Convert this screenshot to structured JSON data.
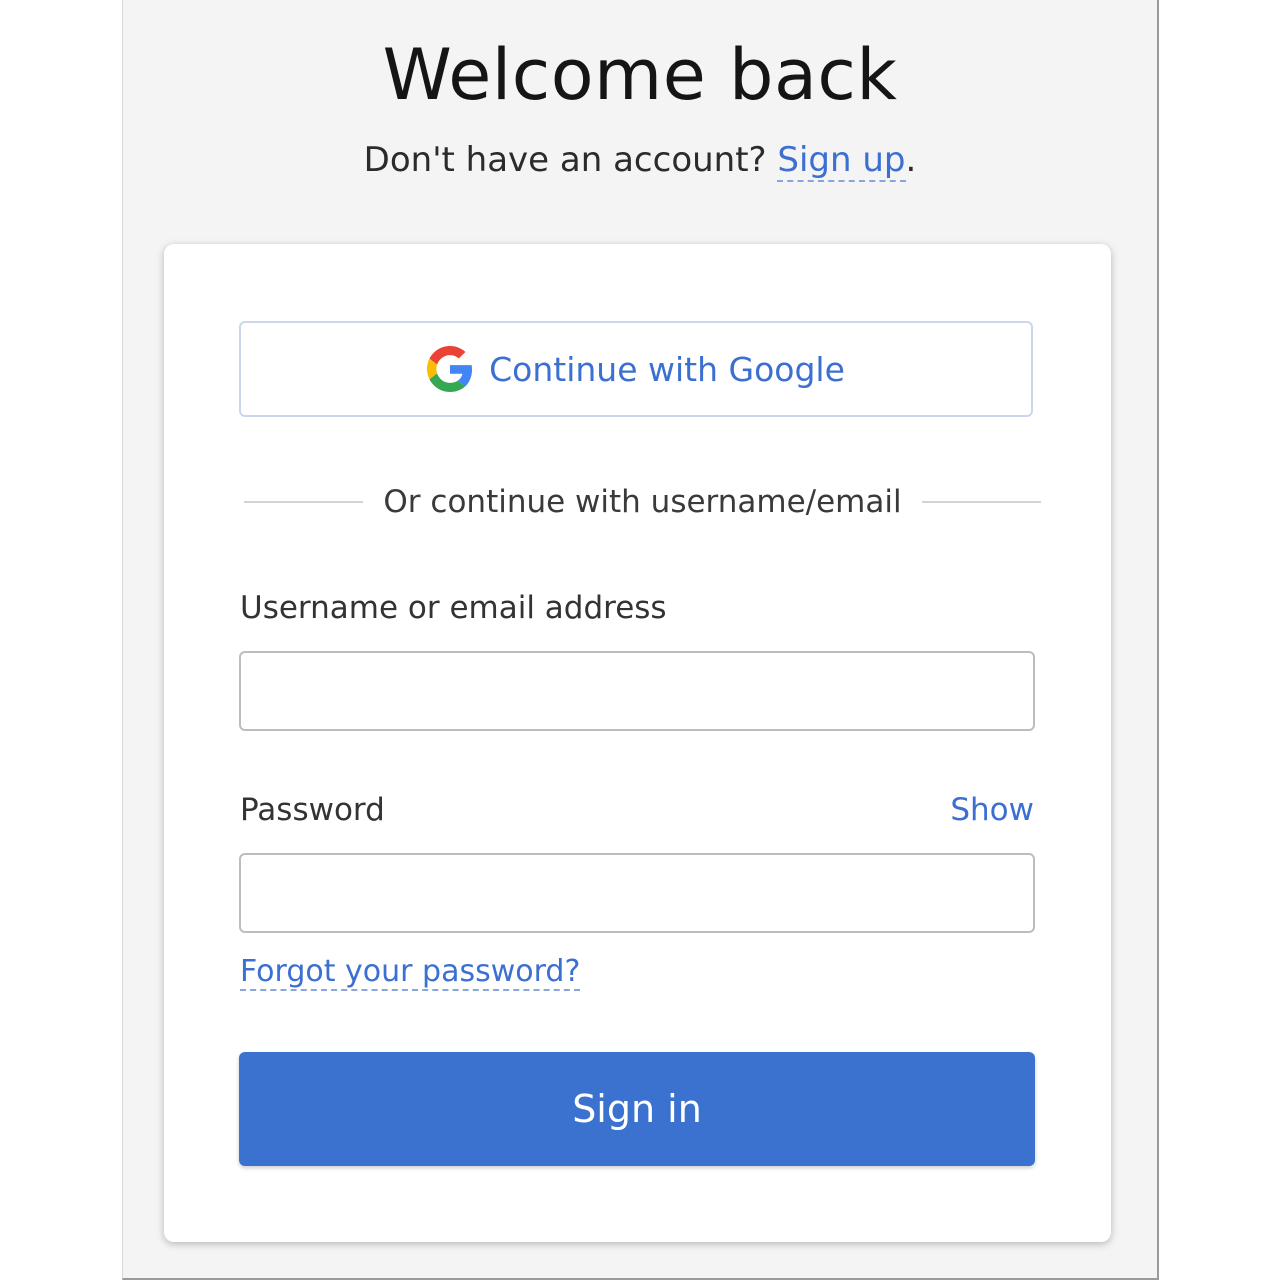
{
  "header": {
    "title": "Welcome back",
    "subtitle_prefix": "Don't have an account?",
    "signup_link": "Sign up",
    "subtitle_suffix": "."
  },
  "oauth": {
    "google_label": "Continue with Google",
    "icon": "google-icon"
  },
  "divider": {
    "text": "Or continue with username/email"
  },
  "form": {
    "username_label": "Username or email address",
    "username_value": "",
    "password_label": "Password",
    "password_value": "",
    "show_label": "Show",
    "forgot_label": "Forgot your password?",
    "submit_label": "Sign in"
  },
  "colors": {
    "accent": "#3b72cf",
    "link": "#3b6fd1",
    "background": "#f4f4f4",
    "card": "#ffffff"
  }
}
